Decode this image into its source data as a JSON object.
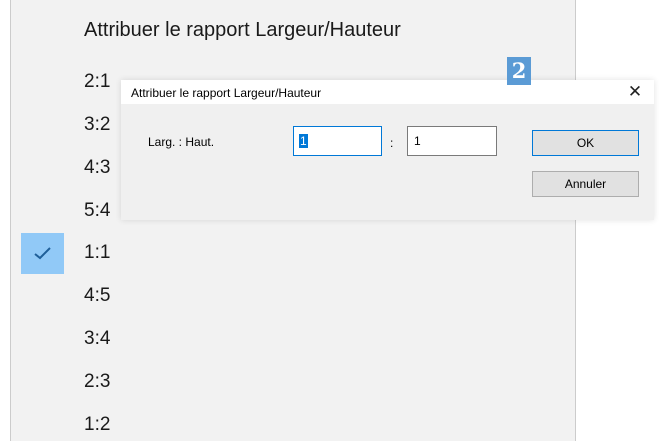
{
  "menu": {
    "title": "Attribuer le rapport Largeur/Hauteur",
    "items": [
      {
        "label": "2:1",
        "checked": false
      },
      {
        "label": "3:2",
        "checked": false
      },
      {
        "label": "4:3",
        "checked": false
      },
      {
        "label": "5:4",
        "checked": false
      },
      {
        "label": "1:1",
        "checked": true
      },
      {
        "label": "4:5",
        "checked": false
      },
      {
        "label": "3:4",
        "checked": false
      },
      {
        "label": "2:3",
        "checked": false
      },
      {
        "label": "1:2",
        "checked": false
      }
    ]
  },
  "dialog": {
    "title": "Attribuer le rapport Largeur/Hauteur",
    "close_glyph": "✕",
    "field_label": "Larg. : Haut.",
    "width_value": "1",
    "separator": ":",
    "height_value": "1",
    "ok_label": "OK",
    "cancel_label": "Annuler"
  },
  "step_badge": "2",
  "colors": {
    "check_highlight": "#91c9f7",
    "badge": "#5b9bd5",
    "focus_border": "#0078d7"
  },
  "icons": {
    "check": "checkmark-icon",
    "close": "close-icon"
  }
}
